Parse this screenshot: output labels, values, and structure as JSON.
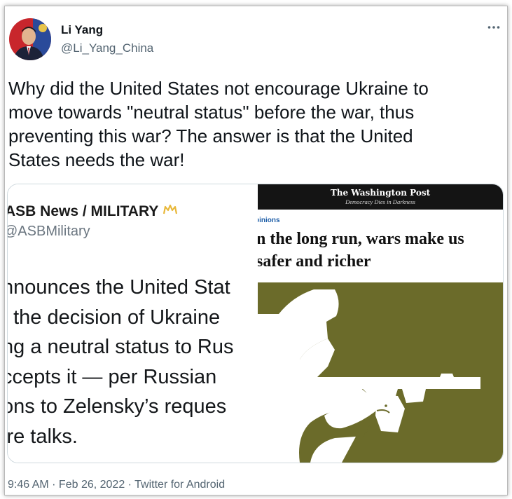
{
  "tweet": {
    "author_name": "Li Yang",
    "author_handle": "@Li_Yang_China",
    "more_icon": "more-horizontal-icon",
    "text_lines": [
      "Why did the United States not encourage Ukraine to",
      "move towards \"neutral status\" before the war, thus",
      "preventing this war? The answer is that the United",
      "States needs the war!"
    ],
    "timestamp": "9:46 AM · Feb 26, 2022 · Twitter for Android"
  },
  "media_left": {
    "account_name": "ASB News / MILITARY",
    "account_handle": "@ASBMilitary",
    "badge_icon": "crown-icon",
    "badge_color": "#e8b83a",
    "body_lines": [
      "nnounces the United Stat",
      "t the decision of Ukraine",
      "ng a neutral status to Rus",
      "ccepts it — per Russian",
      "ons to Zelensky’s reques",
      "ire talks."
    ]
  },
  "media_right": {
    "masthead": "The Washington Post",
    "tagline": "Democracy Dies in Darkness",
    "section": "pinions",
    "headline_lines": [
      "n the long run, wars make us",
      "safer and richer"
    ],
    "illustration_color": "#6b6b2a",
    "section_color": "#1f5fa8"
  }
}
